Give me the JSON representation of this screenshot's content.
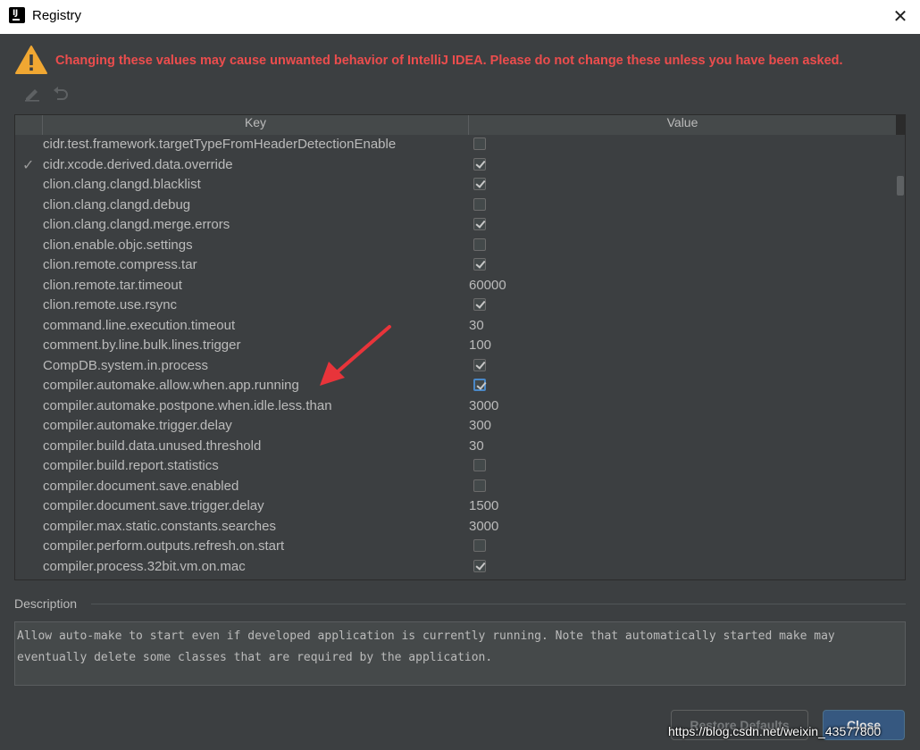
{
  "window": {
    "title": "Registry",
    "close_glyph": "✕"
  },
  "warning": {
    "icon": "warning-triangle-icon",
    "text": "Changing these values may cause unwanted behavior of IntelliJ IDEA. Please do not change these unless you have been asked."
  },
  "toolbar": {
    "edit_icon": "pencil-icon",
    "undo_icon": "undo-icon"
  },
  "table": {
    "columns": [
      "Key",
      "Value"
    ],
    "rows": [
      {
        "key": "cidr.test.framework.targetTypeFromHeaderDetectionEnable",
        "type": "bool",
        "checked": false,
        "modified": false
      },
      {
        "key": "cidr.xcode.derived.data.override",
        "type": "bool",
        "checked": true,
        "modified": true
      },
      {
        "key": "clion.clang.clangd.blacklist",
        "type": "bool",
        "checked": true,
        "modified": false
      },
      {
        "key": "clion.clang.clangd.debug",
        "type": "bool",
        "checked": false,
        "modified": false
      },
      {
        "key": "clion.clang.clangd.merge.errors",
        "type": "bool",
        "checked": true,
        "modified": false
      },
      {
        "key": "clion.enable.objc.settings",
        "type": "bool",
        "checked": false,
        "modified": false
      },
      {
        "key": "clion.remote.compress.tar",
        "type": "bool",
        "checked": true,
        "modified": false
      },
      {
        "key": "clion.remote.tar.timeout",
        "type": "text",
        "value": "60000",
        "modified": false
      },
      {
        "key": "clion.remote.use.rsync",
        "type": "bool",
        "checked": true,
        "modified": false
      },
      {
        "key": "command.line.execution.timeout",
        "type": "text",
        "value": "30",
        "modified": false
      },
      {
        "key": "comment.by.line.bulk.lines.trigger",
        "type": "text",
        "value": "100",
        "modified": false
      },
      {
        "key": "CompDB.system.in.process",
        "type": "bool",
        "checked": true,
        "modified": false
      },
      {
        "key": "compiler.automake.allow.when.app.running",
        "type": "bool",
        "checked": true,
        "modified": false,
        "focused": true
      },
      {
        "key": "compiler.automake.postpone.when.idle.less.than",
        "type": "text",
        "value": "3000",
        "modified": false
      },
      {
        "key": "compiler.automake.trigger.delay",
        "type": "text",
        "value": "300",
        "modified": false
      },
      {
        "key": "compiler.build.data.unused.threshold",
        "type": "text",
        "value": "30",
        "modified": false
      },
      {
        "key": "compiler.build.report.statistics",
        "type": "bool",
        "checked": false,
        "modified": false
      },
      {
        "key": "compiler.document.save.enabled",
        "type": "bool",
        "checked": false,
        "modified": false
      },
      {
        "key": "compiler.document.save.trigger.delay",
        "type": "text",
        "value": "1500",
        "modified": false
      },
      {
        "key": "compiler.max.static.constants.searches",
        "type": "text",
        "value": "3000",
        "modified": false
      },
      {
        "key": "compiler.perform.outputs.refresh.on.start",
        "type": "bool",
        "checked": false,
        "modified": false
      },
      {
        "key": "compiler.process.32bit.vm.on.mac",
        "type": "bool",
        "checked": true,
        "modified": false
      }
    ],
    "modified_glyph": "✓"
  },
  "description": {
    "label": "Description",
    "text": "Allow auto-make to start even if developed application is currently running. Note that automatically started make may eventually delete some classes that are required by the application."
  },
  "buttons": {
    "restore": "Restore Defaults",
    "close": "Close"
  },
  "watermark": "https://blog.csdn.net/weixin_43577800",
  "colors": {
    "background": "#3c3f41",
    "warning": "#ec4d4d",
    "primary_button": "#365880",
    "annotation_arrow": "#e8343a"
  }
}
